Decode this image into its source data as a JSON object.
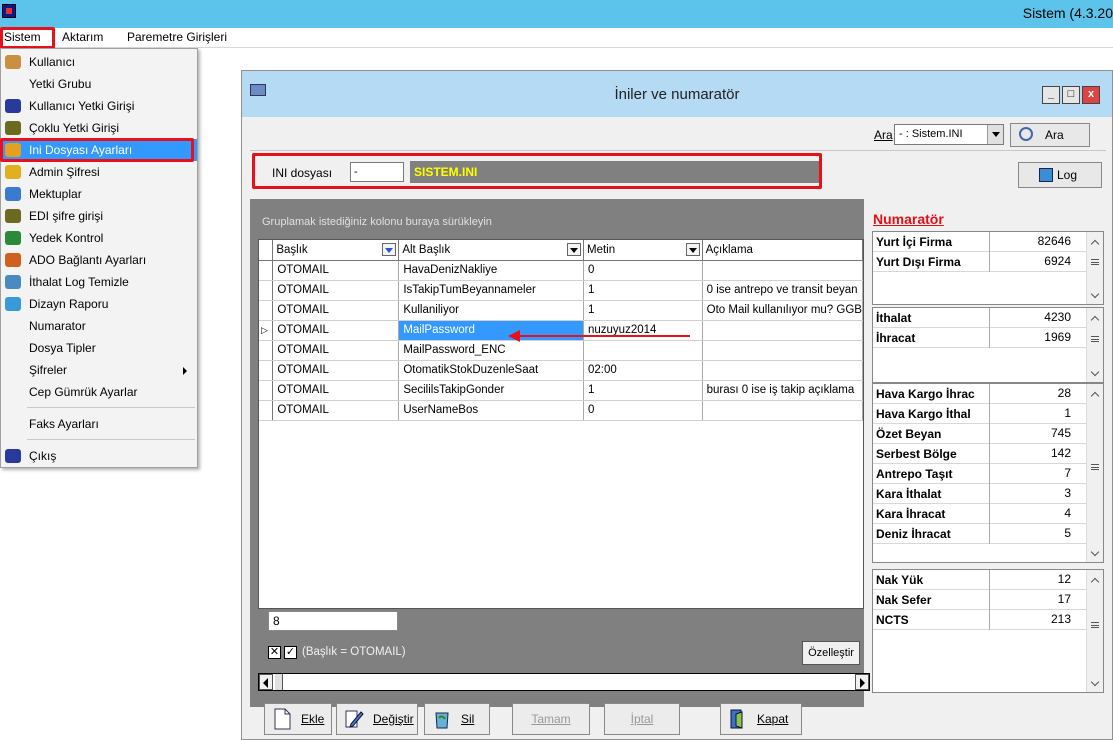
{
  "app": {
    "title": "Sistem (4.3.20"
  },
  "menubar": {
    "items": [
      "Sistem",
      "Aktarım",
      "Paremetre Girişleri"
    ]
  },
  "dropdown": {
    "items": [
      {
        "label": "Kullanıcı",
        "icon": "user-icon"
      },
      {
        "label": "Yetki Grubu",
        "icon": ""
      },
      {
        "label": "Kullanıcı Yetki Girişi",
        "icon": "user-permission-icon"
      },
      {
        "label": "Çoklu Yetki Girişi",
        "icon": "multi-permission-icon"
      },
      {
        "label": "Ini Dosyası Ayarları",
        "icon": "ini-settings-icon",
        "selected": true
      },
      {
        "label": "Admin Şifresi",
        "icon": "key-icon"
      },
      {
        "label": "Mektuplar",
        "icon": "letters-icon"
      },
      {
        "label": "EDI şifre girişi",
        "icon": "edi-key-icon"
      },
      {
        "label": "Yedek Kontrol",
        "icon": "backup-icon"
      },
      {
        "label": "ADO Bağlantı Ayarları",
        "icon": "connection-icon"
      },
      {
        "label": "İthalat Log Temizle",
        "icon": "clean-log-icon"
      },
      {
        "label": "Dizayn Raporu",
        "icon": "report-icon"
      },
      {
        "label": "Numarator",
        "icon": ""
      },
      {
        "label": "Dosya Tipler",
        "icon": ""
      },
      {
        "label": "Şifreler",
        "icon": "",
        "submenu": true
      },
      {
        "label": "Cep Gümrük Ayarlar",
        "icon": ""
      },
      {
        "label": "Faks Ayarları",
        "icon": ""
      },
      {
        "label": "Çıkış",
        "icon": "exit-icon"
      }
    ]
  },
  "window": {
    "title": "İniler ve numaratör",
    "min": "_",
    "max": "□",
    "close": "x"
  },
  "search": {
    "label": "Ara",
    "select_value": "- : Sistem.INI",
    "button": "Ara"
  },
  "ini": {
    "label": "INI dosyası",
    "input_value": "-",
    "value": "SISTEM.INI"
  },
  "log_button": "Log",
  "grid": {
    "group_hint": "Gruplamak istediğiniz kolonu buraya sürükleyin",
    "columns": [
      "Başlık",
      "Alt Başlık",
      "Metin",
      "Açıklama"
    ],
    "rows": [
      [
        "OTOMAIL",
        "HavaDenizNakliye",
        "0",
        ""
      ],
      [
        "OTOMAIL",
        "IsTakipTumBeyannameler",
        "1",
        "0 ise antrepo ve transit  beyan"
      ],
      [
        "OTOMAIL",
        "Kullaniliyor",
        "1",
        "Oto Mail kullanılıyor mu? GGB"
      ],
      [
        "OTOMAIL",
        "MailPassword",
        "nuzuyuz2014",
        ""
      ],
      [
        "OTOMAIL",
        "MailPassword_ENC",
        "",
        ""
      ],
      [
        "OTOMAIL",
        "OtomatikStokDuzenleSaat",
        "02:00",
        ""
      ],
      [
        "OTOMAIL",
        "SecililsTakipGonder",
        "1",
        "burası 0 ise iş takip açıklama"
      ],
      [
        "OTOMAIL",
        "UserNameBos",
        "0",
        ""
      ]
    ],
    "selected_row": 3,
    "count": "8",
    "filter_text": "(Başlık = OTOMAIL)",
    "customize_button": "Özelleştir"
  },
  "buttons": [
    "Ekle",
    "Değiştir",
    "Sil",
    "Tamam",
    "İptal",
    "Kapat"
  ],
  "numarator": {
    "title": "Numaratör",
    "groups": [
      [
        [
          "Yurt İçi Firma",
          "82646"
        ],
        [
          "Yurt Dışı Firma",
          "6924"
        ]
      ],
      [
        [
          "İthalat",
          "4230"
        ],
        [
          "İhracat",
          "1969"
        ]
      ],
      [
        [
          "Hava Kargo İhrac",
          "28"
        ],
        [
          "Hava Kargo İthal",
          "1"
        ],
        [
          "Özet Beyan",
          "745"
        ],
        [
          "Serbest Bölge",
          "142"
        ],
        [
          "Antrepo Taşıt",
          "7"
        ],
        [
          "Kara İthalat",
          "3"
        ],
        [
          "Kara İhracat",
          "4"
        ],
        [
          "Deniz İhracat",
          "5"
        ]
      ],
      [
        [
          "Nak Yük",
          "12"
        ],
        [
          "Nak Sefer",
          "17"
        ],
        [
          "NCTS",
          "213"
        ]
      ]
    ]
  },
  "colors": {
    "titlebar": "#5cc3ea",
    "highlight": "#3399ff",
    "annotation": "#e8101a",
    "ini_value_text": "#ffff00"
  }
}
